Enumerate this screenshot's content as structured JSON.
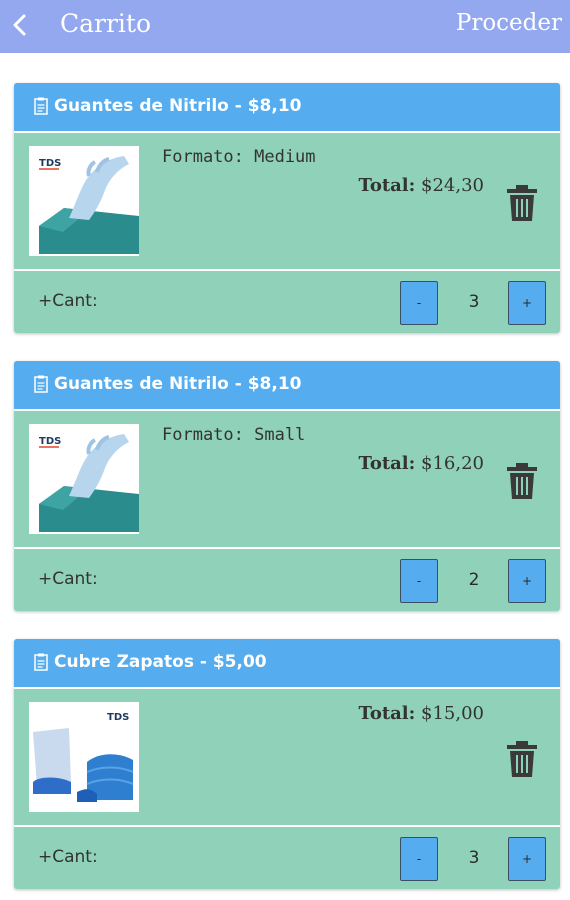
{
  "header": {
    "title": "Carrito",
    "proceed_label": "Proceder"
  },
  "items": [
    {
      "name": "Guantes de Nitrilo - $8,10",
      "image": "glove-box-image",
      "format": "Formato: Medium",
      "total_label": "Total:",
      "total_value": "$24,30",
      "qty_label": "Cant:",
      "qty": "3",
      "minus": "-",
      "plus": "+"
    },
    {
      "name": "Guantes de Nitrilo - $8,10",
      "image": "glove-box-image",
      "format": "Formato: Small",
      "total_label": "Total:",
      "total_value": "$16,20",
      "qty_label": "Cant:",
      "qty": "2",
      "minus": "-",
      "plus": "+"
    },
    {
      "name": "Cubre Zapatos - $5,00",
      "image": "shoe-cover-image",
      "format": "",
      "total_label": "Total:",
      "total_value": "$15,00",
      "qty_label": "Cant:",
      "qty": "3",
      "minus": "-",
      "plus": "+"
    }
  ],
  "image_text": {
    "brand": "TDS"
  },
  "colors": {
    "topbar": "#93a8ef",
    "card_header": "#55acee",
    "card_body": "#8fd1b9"
  }
}
